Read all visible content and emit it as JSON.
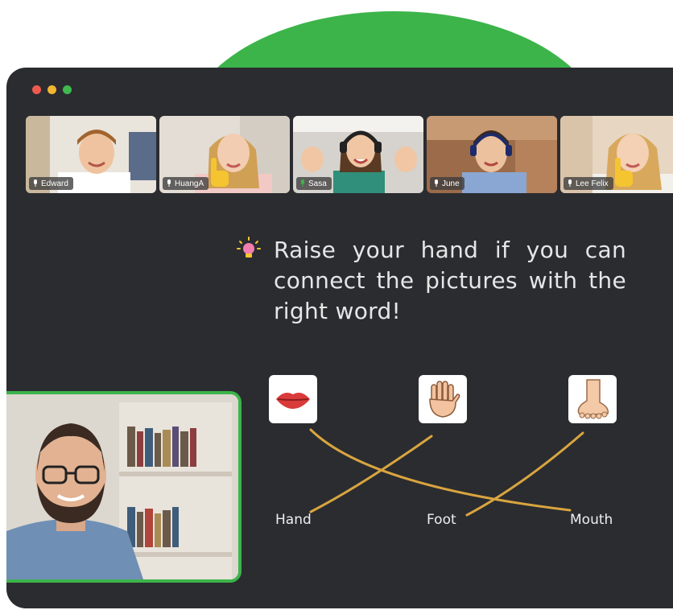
{
  "window": {
    "traffic_lights": [
      "#ef5a4f",
      "#f2b632",
      "#3fb950"
    ]
  },
  "participants": [
    {
      "name": "Edward",
      "hand_raised": false,
      "mic": "muted"
    },
    {
      "name": "HuangA",
      "hand_raised": true,
      "mic": "muted"
    },
    {
      "name": "Sasa",
      "hand_raised": false,
      "mic": "active"
    },
    {
      "name": "June",
      "hand_raised": false,
      "mic": "muted"
    },
    {
      "name": "Lee Felix",
      "hand_raised": true,
      "mic": "muted"
    }
  ],
  "activity": {
    "prompt": "Raise your hand if you can connect the pictures with the right word!",
    "icon": "lightbulb-icon",
    "pictures": [
      "lips-icon",
      "hand-icon",
      "foot-icon"
    ],
    "words": [
      "Hand",
      "Foot",
      "Mouth"
    ]
  },
  "colors": {
    "accent": "#3cb44a",
    "window_bg": "#2b2c30",
    "line": "#d9a53f",
    "hand_badge": "#f5c531"
  }
}
